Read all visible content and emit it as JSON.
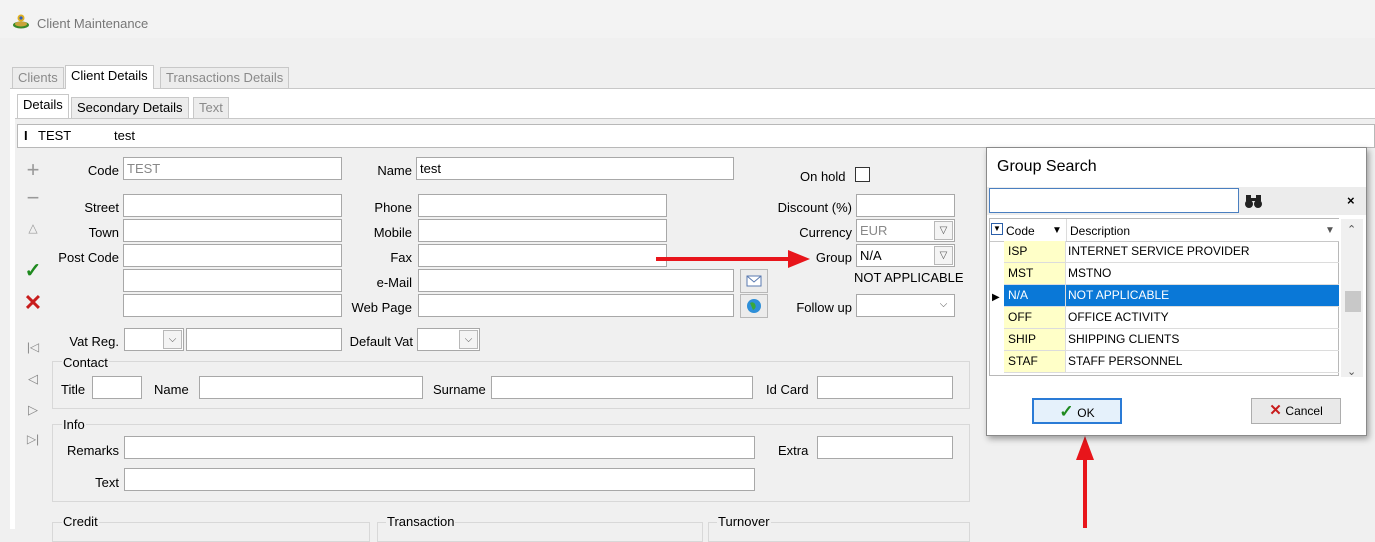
{
  "window": {
    "title": "Client Maintenance"
  },
  "main_tabs": [
    "Clients",
    "Client Details",
    "Transactions Details"
  ],
  "sub_tabs": [
    "Details",
    "Secondary Details",
    "Text"
  ],
  "record_bar": {
    "code": "TEST",
    "name": "test"
  },
  "form": {
    "code_label": "Code",
    "code_value": "TEST",
    "name_label": "Name",
    "name_value": "test",
    "street_label": "Street",
    "town_label": "Town",
    "postcode_label": "Post Code",
    "phone_label": "Phone",
    "mobile_label": "Mobile",
    "fax_label": "Fax",
    "email_label": "e-Mail",
    "webpage_label": "Web Page",
    "onhold_label": "On hold",
    "discount_label": "Discount (%)",
    "currency_label": "Currency",
    "currency_value": "EUR",
    "group_label": "Group",
    "group_value": "N/A",
    "group_desc": "NOT APPLICABLE",
    "followup_label": "Follow up",
    "vatreg_label": "Vat Reg.",
    "defaultvat_label": "Default Vat",
    "contact_label": "Contact",
    "title_label": "Title",
    "cname_label": "Name",
    "surname_label": "Surname",
    "idcard_label": "Id Card",
    "info_label": "Info",
    "remarks_label": "Remarks",
    "extra_label": "Extra",
    "text_label": "Text",
    "credit_label": "Credit",
    "transaction_label": "Transaction",
    "turnover_label": "Turnover"
  },
  "dialog": {
    "title": "Group Search",
    "search_value": "",
    "col_code": "Code",
    "col_desc": "Description",
    "rows": [
      {
        "code": "ISP",
        "desc": "INTERNET SERVICE PROVIDER"
      },
      {
        "code": "MST",
        "desc": "MSTNO"
      },
      {
        "code": "N/A",
        "desc": "NOT APPLICABLE"
      },
      {
        "code": "OFF",
        "desc": "OFFICE ACTIVITY"
      },
      {
        "code": "SHIP",
        "desc": "SHIPPING CLIENTS"
      },
      {
        "code": "STAF",
        "desc": "STAFF PERSONNEL"
      }
    ],
    "selected_index": 2,
    "ok_label": "OK",
    "cancel_label": "Cancel",
    "close_glyph": "×"
  },
  "colors": {
    "selection": "#0a78d7",
    "arrow": "#e8151b",
    "code_cell": "#ffffc8"
  }
}
